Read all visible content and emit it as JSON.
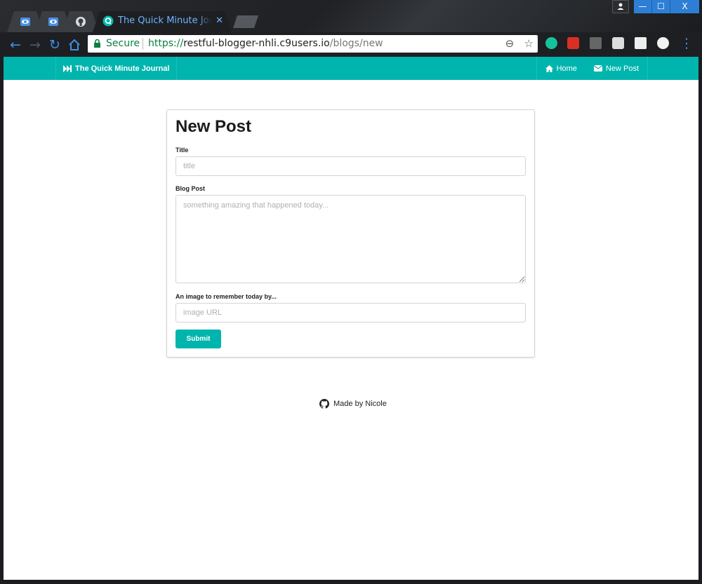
{
  "browser": {
    "active_tab_title": "The Quick Minute Journal",
    "tab_close": "✕",
    "secure_label": "Secure",
    "url_scheme": "https://",
    "url_host": "restful-blogger-nhli.c9users.io",
    "url_path": "/blogs/new",
    "window_controls": {
      "minimize": "—",
      "maximize": "☐",
      "close": "X"
    },
    "icons": [
      "eye-tab-icon",
      "eye-tab-icon",
      "github-tab-icon",
      "journal-favicon"
    ],
    "extensions": [
      "grammarly-icon",
      "red-lock-icon",
      "envelope-icon",
      "s-icon",
      "shield-icon",
      "circle-icon"
    ]
  },
  "navbar": {
    "brand": "The Quick Minute Journal",
    "home": "Home",
    "new_post": "New Post",
    "accent": "#00b5ad"
  },
  "form": {
    "heading": "New Post",
    "title_label": "Title",
    "title_placeholder": "title",
    "body_label": "Blog Post",
    "body_placeholder": "something amazing that happened today...",
    "image_label": "An image to remember today by...",
    "image_placeholder": "image URL",
    "submit": "Submit"
  },
  "footer": {
    "text": "Made by Nicole"
  }
}
